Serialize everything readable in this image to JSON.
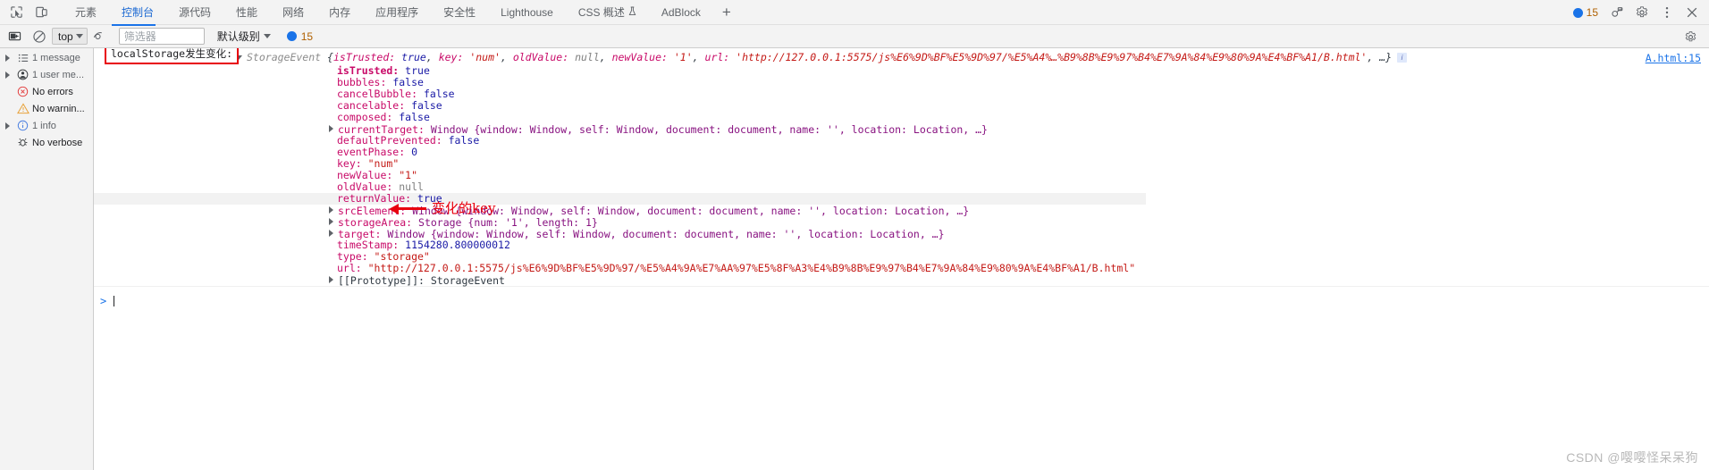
{
  "tabbar": {
    "left_icons": [
      "inspect-element-icon",
      "device-toolbar-icon"
    ],
    "tabs": [
      {
        "label": "元素",
        "active": false
      },
      {
        "label": "控制台",
        "active": true
      },
      {
        "label": "源代码",
        "active": false
      },
      {
        "label": "性能",
        "active": false
      },
      {
        "label": "网络",
        "active": false
      },
      {
        "label": "内存",
        "active": false
      },
      {
        "label": "应用程序",
        "active": false
      },
      {
        "label": "安全性",
        "active": false
      },
      {
        "label": "Lighthouse",
        "active": false
      },
      {
        "label": "CSS 概述",
        "active": false,
        "badge": "beta-flask-icon"
      },
      {
        "label": "AdBlock",
        "active": false
      }
    ],
    "add_tab_label": "+",
    "issues_count": "15",
    "right_icons": [
      "settings-gear-icon",
      "more-options-icon",
      "close-icon",
      "devtools-customize-icon"
    ]
  },
  "console_toolbar": {
    "clear_console_label": "clear-console-icon",
    "no_entry_label": "no-entry-icon",
    "context_selector": "top",
    "eye_icon": "live-expression-eye-icon",
    "filter_placeholder": "筛选器",
    "filter_value": "",
    "level_selector": "默认级别",
    "message_count": "15",
    "settings_icon": "console-settings-gear-icon"
  },
  "sidebar": {
    "items": [
      {
        "label": "1 message",
        "icon": "list-icon",
        "expandable": true,
        "dark": false
      },
      {
        "label": "1 user me...",
        "icon": "user-icon",
        "expandable": true,
        "dark": false
      },
      {
        "label": "No errors",
        "icon": "error-circle-icon",
        "expandable": false,
        "dark": true
      },
      {
        "label": "No warnin...",
        "icon": "warning-triangle-icon",
        "expandable": false,
        "dark": true
      },
      {
        "label": "1 info",
        "icon": "info-circle-icon",
        "expandable": true,
        "dark": false
      },
      {
        "label": "No verbose",
        "icon": "verbose-bug-icon",
        "expandable": false,
        "dark": true
      }
    ]
  },
  "console": {
    "annotation_box": "localStorage发生变化:",
    "source_link": "A.html:15",
    "info_badge": "i",
    "object_header": {
      "class_name": "StorageEvent",
      "preview_parts": [
        {
          "text": "{",
          "kind": "punc"
        },
        {
          "text": "isTrusted: ",
          "kind": "name"
        },
        {
          "text": "true",
          "kind": "kw"
        },
        {
          "text": ", ",
          "kind": "punc"
        },
        {
          "text": "key: ",
          "kind": "name"
        },
        {
          "text": "'num'",
          "kind": "str"
        },
        {
          "text": ", ",
          "kind": "punc"
        },
        {
          "text": "oldValue: ",
          "kind": "name"
        },
        {
          "text": "null",
          "kind": "null"
        },
        {
          "text": ", ",
          "kind": "punc"
        },
        {
          "text": "newValue: ",
          "kind": "name"
        },
        {
          "text": "'1'",
          "kind": "str"
        },
        {
          "text": ", ",
          "kind": "punc"
        },
        {
          "text": "url: ",
          "kind": "name"
        },
        {
          "text": "'http://127.0.0.1:5575/js%E6%9D%BF%E5%9D%97/%E5%A4%…%B9%8B%E9%97%B4%E7%9A%84%E9%80%9A%E4%BF%A1/B.html'",
          "kind": "str"
        },
        {
          "text": ", …}",
          "kind": "punc"
        }
      ]
    },
    "properties": [
      {
        "name": "isTrusted",
        "value": "true",
        "kind": "kw",
        "expandable": false,
        "bold_name": true,
        "highlight": false
      },
      {
        "name": "bubbles",
        "value": "false",
        "kind": "kw",
        "expandable": false,
        "bold_name": false,
        "highlight": false
      },
      {
        "name": "cancelBubble",
        "value": "false",
        "kind": "kw",
        "expandable": false,
        "bold_name": false,
        "highlight": false
      },
      {
        "name": "cancelable",
        "value": "false",
        "kind": "kw",
        "expandable": false,
        "bold_name": false,
        "highlight": false
      },
      {
        "name": "composed",
        "value": "false",
        "kind": "kw",
        "expandable": false,
        "bold_name": false,
        "highlight": false
      },
      {
        "name": "currentTarget",
        "value": "Window {window: Window, self: Window, document: document, name: '', location: Location, …}",
        "kind": "win",
        "expandable": true,
        "bold_name": false,
        "highlight": false
      },
      {
        "name": "defaultPrevented",
        "value": "false",
        "kind": "kw",
        "expandable": false,
        "bold_name": false,
        "highlight": false
      },
      {
        "name": "eventPhase",
        "value": "0",
        "kind": "kw",
        "expandable": false,
        "bold_name": false,
        "highlight": false
      },
      {
        "name": "key",
        "value": "\"num\"",
        "kind": "str",
        "expandable": false,
        "bold_name": false,
        "highlight": false
      },
      {
        "name": "newValue",
        "value": "\"1\"",
        "kind": "str",
        "expandable": false,
        "bold_name": false,
        "highlight": false
      },
      {
        "name": "oldValue",
        "value": "null",
        "kind": "null",
        "expandable": false,
        "bold_name": false,
        "highlight": false
      },
      {
        "name": "returnValue",
        "value": "true",
        "kind": "kw",
        "expandable": false,
        "bold_name": false,
        "highlight": true
      },
      {
        "name": "srcElement",
        "value": "Window {window: Window, self: Window, document: document, name: '', location: Location, …}",
        "kind": "win",
        "expandable": true,
        "bold_name": false,
        "highlight": false
      },
      {
        "name": "storageArea",
        "value": "Storage {num: '1', length: 1}",
        "kind": "win",
        "expandable": true,
        "bold_name": false,
        "highlight": false
      },
      {
        "name": "target",
        "value": "Window {window: Window, self: Window, document: document, name: '', location: Location, …}",
        "kind": "win",
        "expandable": true,
        "bold_name": false,
        "highlight": false
      },
      {
        "name": "timeStamp",
        "value": "1154280.800000012",
        "kind": "kw",
        "expandable": false,
        "bold_name": false,
        "highlight": false
      },
      {
        "name": "type",
        "value": "\"storage\"",
        "kind": "str",
        "expandable": false,
        "bold_name": false,
        "highlight": false
      },
      {
        "name": "url",
        "value": "\"http://127.0.0.1:5575/js%E6%9D%BF%E5%9D%97/%E5%A4%9A%E7%AA%97%E5%8F%A3%E4%B9%8B%E9%97%B4%E7%9A%84%E9%80%9A%E4%BF%A1/B.html\"",
        "kind": "str",
        "expandable": false,
        "bold_name": false,
        "highlight": false
      },
      {
        "name": "[[Prototype]]",
        "value": "StorageEvent",
        "kind": "proto",
        "expandable": true,
        "bold_name": false,
        "highlight": false
      }
    ],
    "annotation_arrow_text": "变化的key",
    "prompt_symbol": ">"
  },
  "watermark": "CSDN @嘤嘤怪呆呆狗",
  "colors": {
    "accent_blue": "#1a73e8",
    "annotation_red": "#e8000d",
    "toolbar_bg": "#f3f3f3",
    "string_red": "#c41a16",
    "property_pink": "#c80a68"
  }
}
